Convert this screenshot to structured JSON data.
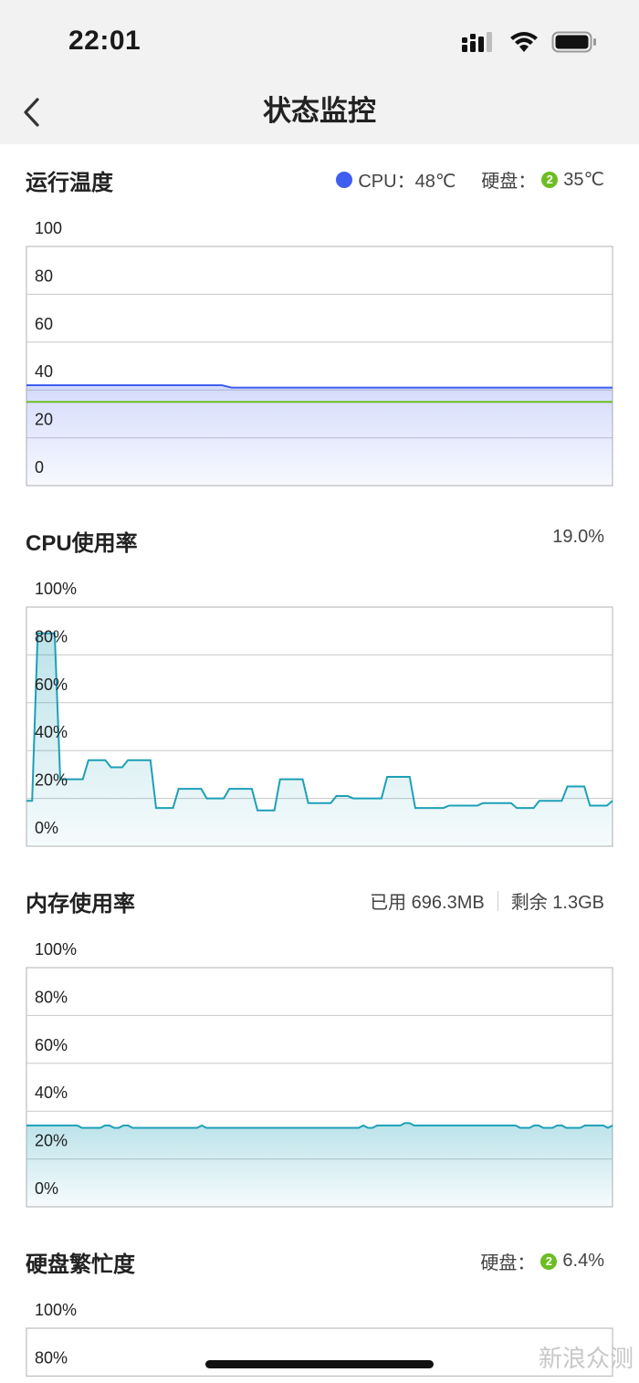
{
  "status_bar": {
    "time": "22:01"
  },
  "nav": {
    "title": "状态监控"
  },
  "temperature": {
    "title": "运行温度",
    "cpu_label": "CPU：48℃",
    "disk_label": "硬盘：",
    "disk_badge": "2",
    "disk_value": "35℃",
    "cpu_color": "#3d5ef0",
    "disk_color": "#6cbd22"
  },
  "cpu_usage": {
    "title": "CPU使用率",
    "value": "19.0%"
  },
  "memory": {
    "title": "内存使用率",
    "used": "已用 696.3MB",
    "free": "剩余 1.3GB"
  },
  "disk_busy": {
    "title": "硬盘繁忙度",
    "label": "硬盘：",
    "badge": "2",
    "value": "6.4%"
  },
  "watermark": "新浪众测",
  "chart_data": [
    {
      "type": "line",
      "title": "运行温度",
      "ylim": [
        0,
        100
      ],
      "yticks": [
        "100",
        "80",
        "60",
        "40",
        "20",
        "0"
      ],
      "series": [
        {
          "name": "CPU",
          "color": "#3d5ef0",
          "values": [
            42,
            42,
            42,
            42,
            42,
            42,
            42,
            42,
            42,
            42,
            42,
            42,
            42,
            42,
            42,
            42,
            42,
            42,
            42,
            42,
            42,
            41,
            41,
            41,
            41,
            41,
            41,
            41,
            41,
            41,
            41,
            41,
            41,
            41,
            41,
            41,
            41,
            41,
            41,
            41,
            41,
            41,
            41,
            41,
            41,
            41,
            41,
            41,
            41,
            41,
            41,
            41,
            41,
            41,
            41,
            41,
            41,
            41,
            41,
            41,
            41
          ]
        },
        {
          "name": "硬盘",
          "color": "#6cbd22",
          "values": [
            35,
            35,
            35,
            35,
            35,
            35,
            35,
            35,
            35,
            35,
            35,
            35,
            35,
            35,
            35,
            35,
            35,
            35,
            35,
            35,
            35,
            35,
            35,
            35,
            35,
            35,
            35,
            35,
            35,
            35,
            35,
            35,
            35,
            35,
            35,
            35,
            35,
            35,
            35,
            35,
            35,
            35,
            35,
            35,
            35,
            35,
            35,
            35,
            35,
            35,
            35,
            35,
            35,
            35,
            35,
            35,
            35,
            35,
            35,
            35,
            35
          ]
        }
      ]
    },
    {
      "type": "area",
      "title": "CPU使用率",
      "ylim": [
        0,
        100
      ],
      "yticks": [
        "100%",
        "80%",
        "60%",
        "40%",
        "20%",
        "0%"
      ],
      "series": [
        {
          "name": "CPU",
          "color": "#1da0b7",
          "values": [
            19,
            19,
            89,
            89,
            89,
            89,
            28,
            28,
            28,
            28,
            28,
            36,
            36,
            36,
            36,
            33,
            33,
            33,
            36,
            36,
            36,
            36,
            36,
            16,
            16,
            16,
            16,
            24,
            24,
            24,
            24,
            24,
            20,
            20,
            20,
            20,
            24,
            24,
            24,
            24,
            24,
            15,
            15,
            15,
            15,
            28,
            28,
            28,
            28,
            28,
            18,
            18,
            18,
            18,
            18,
            21,
            21,
            21,
            20,
            20,
            20,
            20,
            20,
            20,
            29,
            29,
            29,
            29,
            29,
            16,
            16,
            16,
            16,
            16,
            16,
            17,
            17,
            17,
            17,
            17,
            17,
            18,
            18,
            18,
            18,
            18,
            18,
            16,
            16,
            16,
            16,
            19,
            19,
            19,
            19,
            19,
            25,
            25,
            25,
            25,
            17,
            17,
            17,
            17,
            19
          ]
        }
      ]
    },
    {
      "type": "area",
      "title": "内存使用率",
      "ylim": [
        0,
        100
      ],
      "yticks": [
        "100%",
        "80%",
        "60%",
        "40%",
        "20%",
        "0%"
      ],
      "series": [
        {
          "name": "内存",
          "color": "#1da0b7",
          "values": [
            34,
            34,
            34,
            34,
            34,
            34,
            34,
            34,
            34,
            34,
            34,
            34,
            33,
            33,
            33,
            33,
            33,
            34,
            34,
            33,
            33,
            34,
            34,
            33,
            33,
            33,
            33,
            33,
            33,
            33,
            33,
            33,
            33,
            33,
            33,
            33,
            33,
            33,
            34,
            33,
            33,
            33,
            33,
            33,
            33,
            33,
            33,
            33,
            33,
            33,
            33,
            33,
            33,
            33,
            33,
            33,
            33,
            33,
            33,
            33,
            33,
            33,
            33,
            33,
            33,
            33,
            33,
            33,
            33,
            33,
            33,
            33,
            33,
            34,
            33,
            33,
            34,
            34,
            34,
            34,
            34,
            34,
            35,
            35,
            34,
            34,
            34,
            34,
            34,
            34,
            34,
            34,
            34,
            34,
            34,
            34,
            34,
            34,
            34,
            34,
            34,
            34,
            34,
            34,
            34,
            34,
            34,
            33,
            33,
            33,
            34,
            34,
            33,
            33,
            33,
            34,
            34,
            33,
            33,
            33,
            33,
            34,
            34,
            34,
            34,
            34,
            33,
            34
          ]
        }
      ]
    },
    {
      "type": "area",
      "title": "硬盘繁忙度",
      "ylim": [
        0,
        100
      ],
      "yticks": [
        "100%",
        "80%"
      ],
      "series": []
    }
  ]
}
